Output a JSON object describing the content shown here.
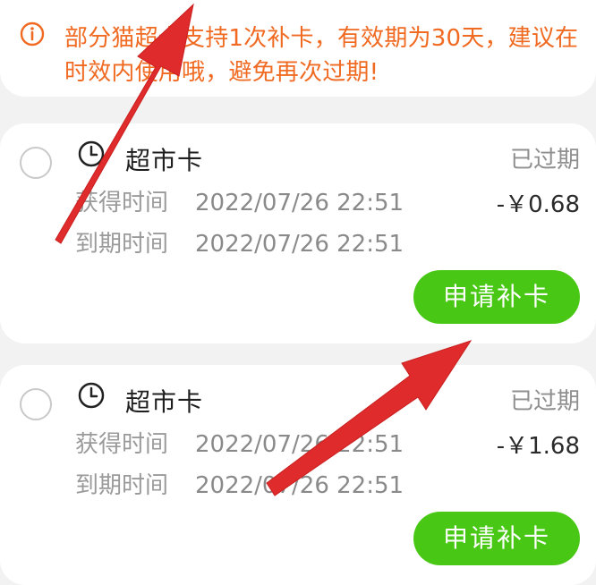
{
  "notice": {
    "icon": "info-circle-icon",
    "text": "部分猫超卡支持1次补卡，有效期为30天，建议在时效内使用哦，避免再次过期!"
  },
  "cards": [
    {
      "radio": "radio-circle",
      "clock_icon": "clock-icon",
      "title": "超市卡",
      "status": "已过期",
      "label_obtain": "获得时间",
      "obtain_time": "2022/07/26 22:51",
      "label_expire": "到期时间",
      "expire_time": "2022/07/26 22:51",
      "amount": "-￥0.68",
      "button": "申请补卡"
    },
    {
      "radio": "radio-circle",
      "clock_icon": "clock-icon",
      "title": "超市卡",
      "status": "已过期",
      "label_obtain": "获得时间",
      "obtain_time": "2022/07/26 22:51",
      "label_expire": "到期时间",
      "expire_time": "2022/07/26 22:51",
      "amount": "-￥1.68",
      "button": "申请补卡"
    }
  ],
  "colors": {
    "notice_text": "#f06a22",
    "button_bg": "#48c814",
    "background": "#f2f2f2",
    "arrow": "#df2b2b"
  }
}
